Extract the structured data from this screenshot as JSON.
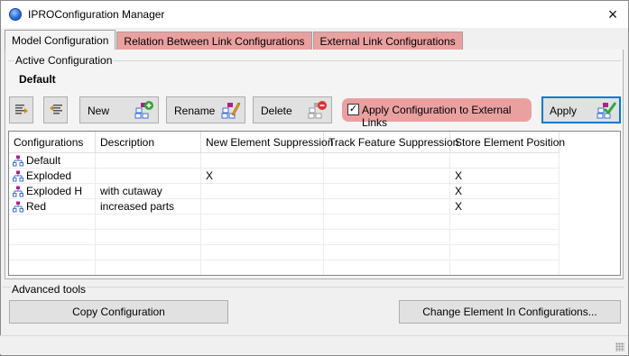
{
  "window": {
    "title": "IPROConfiguration Manager"
  },
  "tabs": [
    {
      "label": "Model Configuration"
    },
    {
      "label": "Relation Between Link Configurations"
    },
    {
      "label": "External Link Configurations"
    }
  ],
  "active_configuration": {
    "group_label": "Active Configuration",
    "name": "Default"
  },
  "toolbar": {
    "new_label": "New",
    "rename_label": "Rename",
    "delete_label": "Delete",
    "apply_external_label": "Apply Configuration to External Links",
    "apply_external_checked": true,
    "apply_label": "Apply"
  },
  "grid": {
    "columns": [
      "Configurations",
      "Description",
      "New Element Suppression",
      "Track Feature Suppression",
      "Store Element Position"
    ],
    "rows": [
      {
        "name": "Default",
        "description": "",
        "new_element_suppression": "",
        "track_feature_suppression": "",
        "store_element_position": ""
      },
      {
        "name": "Exploded",
        "description": "",
        "new_element_suppression": "X",
        "track_feature_suppression": "",
        "store_element_position": "X"
      },
      {
        "name": "Exploded H",
        "description": "with cutaway",
        "new_element_suppression": "",
        "track_feature_suppression": "",
        "store_element_position": "X"
      },
      {
        "name": "Red",
        "description": "increased parts",
        "new_element_suppression": "",
        "track_feature_suppression": "",
        "store_element_position": "X"
      }
    ]
  },
  "advanced_tools": {
    "label": "Advanced tools",
    "copy_label": "Copy Configuration",
    "change_label": "Change Element In Configurations..."
  },
  "colors": {
    "tab_highlight": "#eba0a0",
    "apply_border": "#0078d7",
    "tree_icon_blue": "#3a6fd6",
    "tree_icon_magenta": "#b0208a"
  },
  "icons": {
    "close": "×",
    "new": "config-add-icon",
    "rename": "config-edit-icon",
    "delete": "config-delete-icon",
    "apply": "config-check-icon"
  }
}
